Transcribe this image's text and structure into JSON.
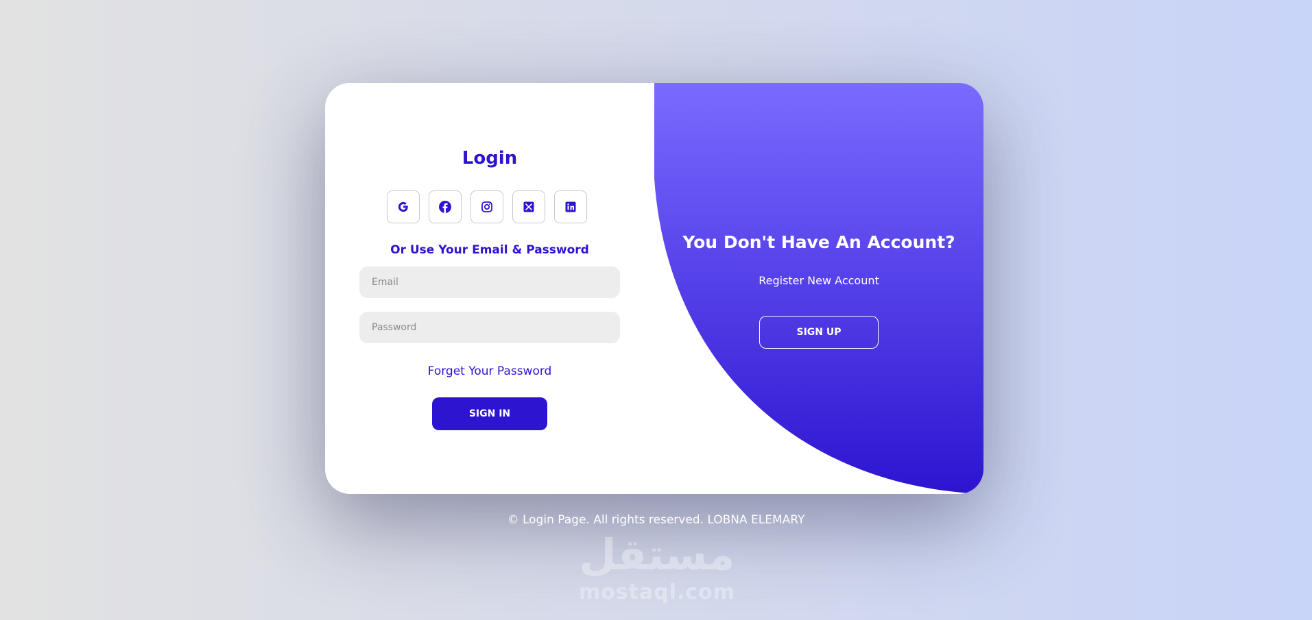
{
  "colors": {
    "accent": "#2d14d0",
    "panel_gradient_top": "#7a6bff",
    "panel_gradient_bottom": "#2d14d0",
    "field_background": "#ededed"
  },
  "login": {
    "title": "Login",
    "social_buttons": [
      {
        "icon": "google-icon",
        "label": "Google"
      },
      {
        "icon": "facebook-icon",
        "label": "Facebook"
      },
      {
        "icon": "instagram-icon",
        "label": "Instagram"
      },
      {
        "icon": "x-icon",
        "label": "X"
      },
      {
        "icon": "linkedin-icon",
        "label": "LinkedIn"
      }
    ],
    "or_text": "Or Use Your Email & Password",
    "email": {
      "placeholder": "Email",
      "value": ""
    },
    "password": {
      "placeholder": "Password",
      "value": ""
    },
    "forget_link": "Forget Your Password",
    "signin_label": "SIGN IN"
  },
  "register": {
    "title": "You Don't Have An Account?",
    "subtitle": "Register New Account",
    "signup_label": "SIGN UP"
  },
  "footer": {
    "text": "© Login Page. All rights reserved. LOBNA ELEMARY"
  },
  "watermark": {
    "arabic": "مستقل",
    "latin": "mostaql.com"
  }
}
